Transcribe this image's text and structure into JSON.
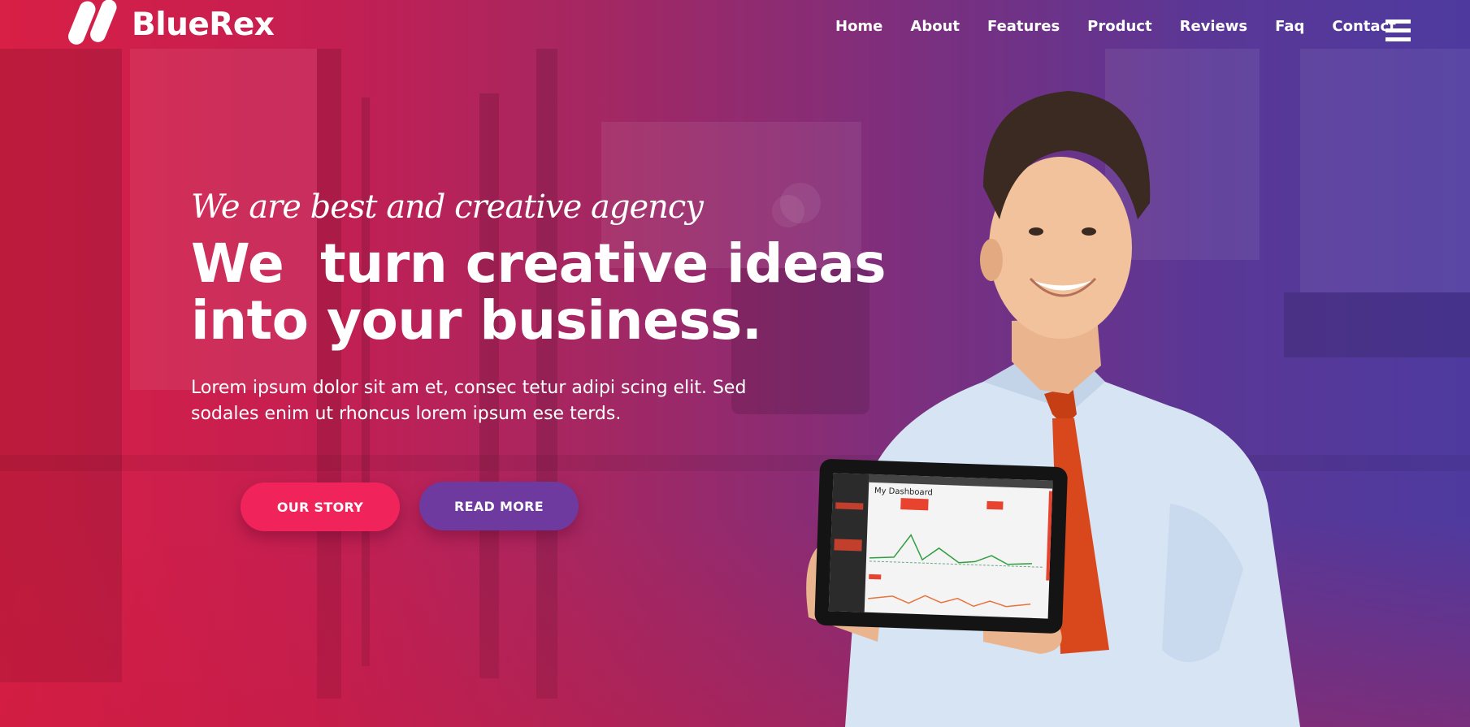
{
  "brand": {
    "name": "BlueRex"
  },
  "nav": {
    "items": [
      {
        "label": "Home"
      },
      {
        "label": "About"
      },
      {
        "label": "Features"
      },
      {
        "label": "Product"
      },
      {
        "label": "Reviews"
      },
      {
        "label": "Faq"
      },
      {
        "label": "Contact"
      }
    ]
  },
  "hero": {
    "tagline": "We are best and creative agency",
    "headline_line1": "We  turn creative ideas",
    "headline_line2": "into your business.",
    "lead": "Lorem ipsum dolor sit am et, consec tetur adipi scing elit. Sed sodales enim ut rhoncus lorem ipsum ese terds.",
    "buttons": {
      "primary": "OUR STORY",
      "secondary": "READ MORE"
    }
  },
  "tablet": {
    "screen_title": "My Dashboard"
  },
  "colors": {
    "gradient_left": "#d81f45",
    "gradient_right": "#4e3a9f",
    "button_primary": "#f0245a",
    "button_secondary": "#6f3aa0",
    "tie": "#d9481c",
    "shirt": "#d6e4f4"
  },
  "icons": {
    "menu": "hamburger-menu-icon",
    "logo": "logo-mark-icon"
  }
}
